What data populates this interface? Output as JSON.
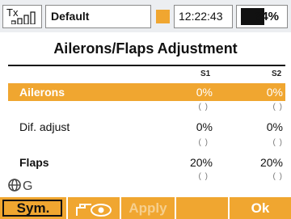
{
  "status": {
    "tx_label": "Tx",
    "model_name": "Default",
    "clock": "12:22:43",
    "battery_percent": "64%",
    "battery_level": 0.64,
    "colors": {
      "accent": "#f0a630",
      "bar_bg": "#eceef1"
    }
  },
  "page": {
    "title": "Ailerons/Flaps Adjustment"
  },
  "columns": [
    "S1",
    "S2"
  ],
  "rows": [
    {
      "label": "Ailerons",
      "values": [
        "0%",
        "0%"
      ],
      "subs": [
        "(  )",
        "(  )"
      ],
      "highlighted": true
    },
    {
      "label": "Dif. adjust",
      "values": [
        "0%",
        "0%"
      ],
      "subs": [
        "(  )",
        "(  )"
      ],
      "highlighted": false
    },
    {
      "label": "Flaps",
      "values": [
        "20%",
        "20%"
      ],
      "subs": [
        "(  )",
        "(  )"
      ],
      "highlighted": false
    }
  ],
  "footer": {
    "sym_label": "Sym.",
    "eye_icon": "servo-eye-icon",
    "apply_label": "Apply",
    "blank_label": "",
    "ok_label": "Ok"
  },
  "gyro_icon_label": "G"
}
